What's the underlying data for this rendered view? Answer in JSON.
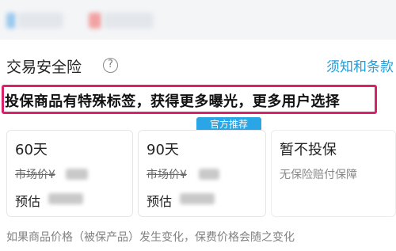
{
  "insurance": {
    "title": "交易安全险",
    "help_icon": "?",
    "notice_link": "须知和条款",
    "highlight_text": "投保商品有特殊标签，获得更多曝光，更多用户选择",
    "badge": "官方推荐"
  },
  "options": [
    {
      "title": "60天",
      "market_price_label": "市场价¥",
      "estimate_label": "预估"
    },
    {
      "title": "90天",
      "market_price_label": "市场价¥",
      "estimate_label": "预估"
    },
    {
      "title": "暂不投保",
      "subtitle": "无保险赔付保障"
    }
  ],
  "footer": {
    "text": "如果商品价格（被保产品）发生变化，保费价格会随之变化"
  },
  "colors": {
    "accent_link": "#1f9ed9",
    "badge_bg": "#2aa5e6",
    "highlight_border": "#d9226c"
  }
}
